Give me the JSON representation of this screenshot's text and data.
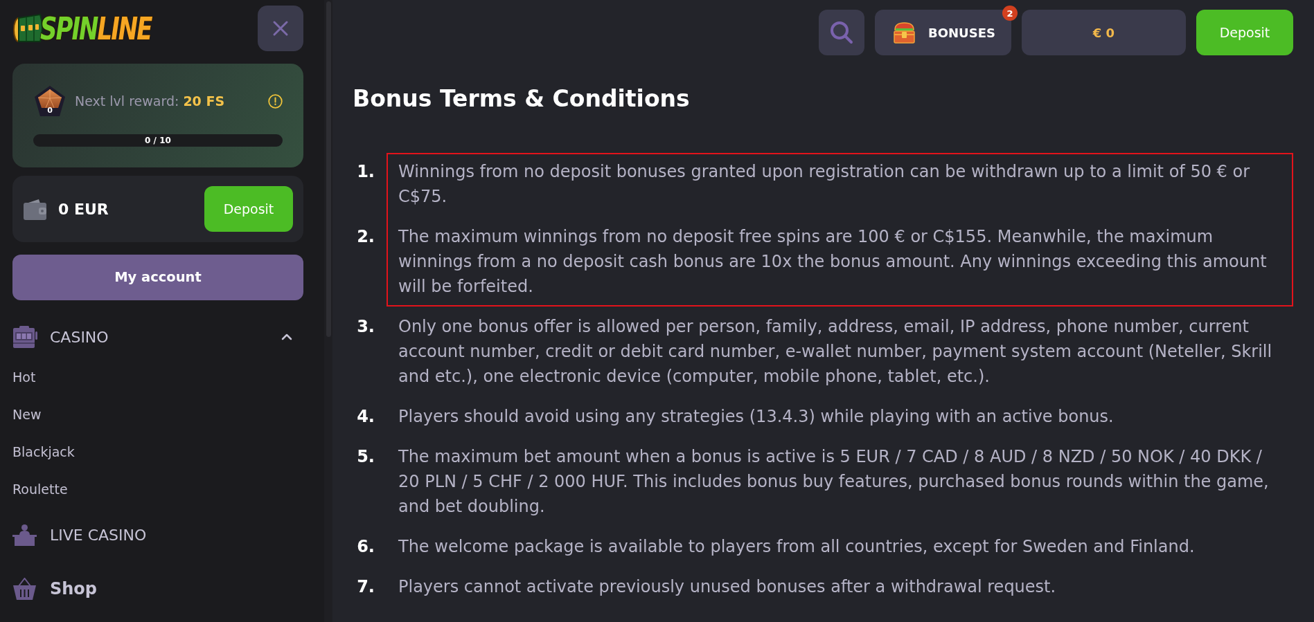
{
  "sidebar": {
    "logo": {
      "parts": [
        "SPIN",
        "LINE"
      ]
    },
    "level_card": {
      "level_badge": "0",
      "reward": "Next lvl reward: **20 FS**",
      "progress": {
        "level": 0,
        "reading": "0 / 10"
      }
    },
    "balance_card": {
      "amount": "0 EUR",
      "deposit_button": "Deposit"
    },
    "account_button": "My account",
    "nav": [
      {
        "kind": "slots",
        "label": "CASINO",
        "expanded": true,
        "children": [
          {
            "label": "Hot"
          },
          {
            "label": "New"
          },
          {
            "label": "Blackjack"
          },
          {
            "label": "Roulette"
          }
        ]
      },
      {
        "kind": "dealer",
        "label": "LIVE CASINO"
      },
      {
        "kind": "basket",
        "label": "Shop"
      }
    ]
  },
  "top_bar": {
    "bonuses_button": {
      "label": "BONUSES",
      "badge": "2"
    },
    "balance_button": "€ 0",
    "deposit_button": "Deposit"
  },
  "page": {
    "title": "Bonus Terms & Conditions",
    "terms": [
      {
        "number": "1.",
        "text": "Winnings from no deposit bonuses granted upon registration can be withdrawn up to a limit of 50 € or C$75.",
        "highlighted": true
      },
      {
        "number": "2.",
        "text": "The maximum winnings from no deposit free spins are 100 € or C$155. Meanwhile, the maximum winnings from a no deposit cash bonus are 10x the bonus amount. Any winnings exceeding this amount will be forfeited.",
        "highlighted": true
      },
      {
        "number": "3.",
        "text": "Only one bonus offer is allowed per person, family, address, email, IP address, phone number, current account number, credit or debit card number, e-wallet number, payment system account (Neteller, Skrill and etc.), one electronic device (computer, mobile phone, tablet, etc.).",
        "highlighted": false
      },
      {
        "number": "4.",
        "text": "Players should avoid using any strategies (13.4.3) while playing with an active bonus.",
        "highlighted": false
      },
      {
        "number": "5.",
        "text": "The maximum bet amount when a bonus is active is 5 EUR / 7 CAD / 8 AUD / 8 NZD / 50 NOK / 40 DKK / 20 PLN / 5 CHF / 2 000 HUF. This includes bonus buy features, purchased bonus rounds within the game, and bet doubling.",
        "highlighted": false
      },
      {
        "number": "6.",
        "text": "The welcome package is available to players from all countries, except for Sweden and Finland.",
        "highlighted": false
      },
      {
        "number": "7.",
        "text": "Players cannot activate previously unused bonuses after a withdrawal request.",
        "highlighted": false
      }
    ]
  }
}
